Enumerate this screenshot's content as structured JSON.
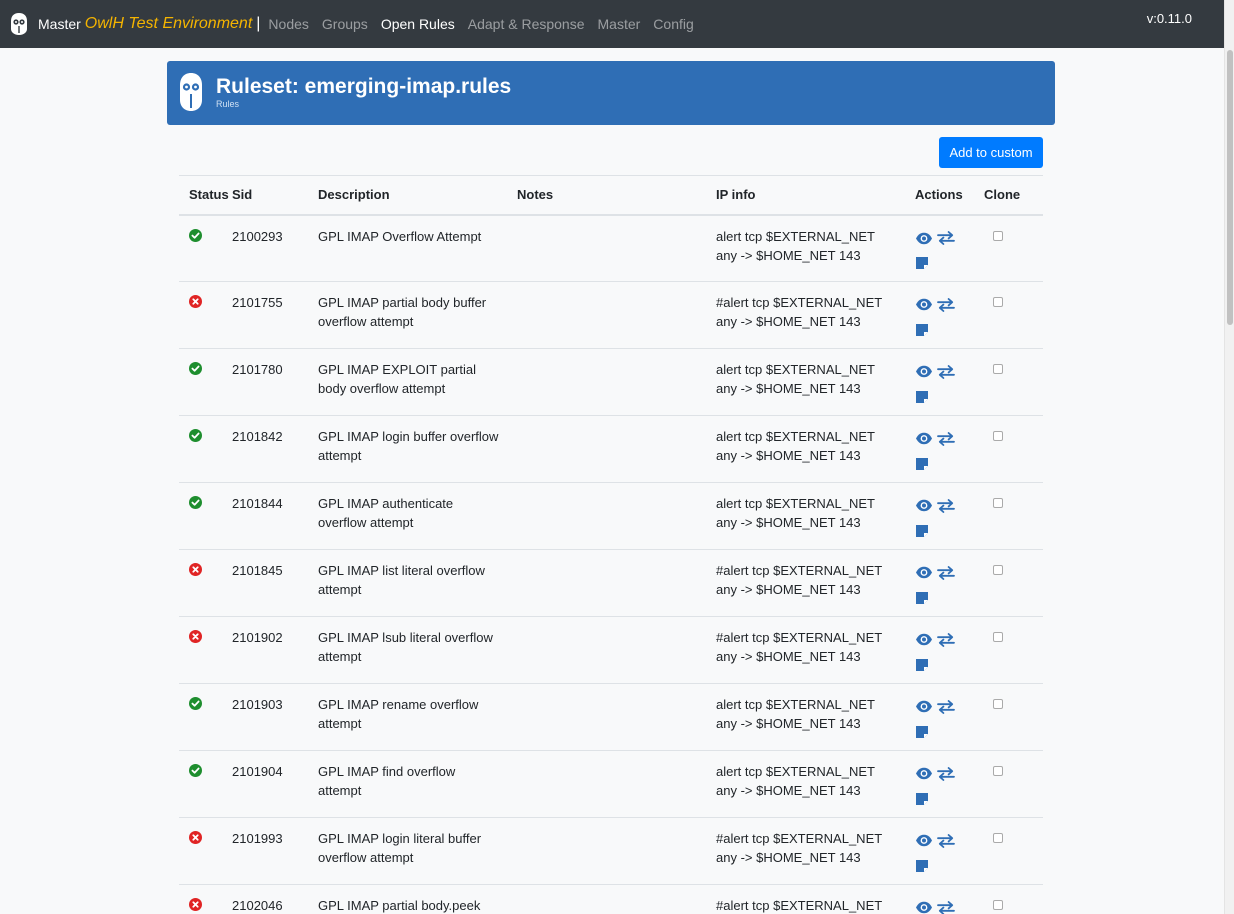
{
  "navbar": {
    "brand_master": "Master",
    "brand_env": "OwlH Test Environment",
    "separator": "|",
    "links": [
      "Nodes",
      "Groups",
      "Open Rules",
      "Adapt & Response",
      "Master",
      "Config"
    ],
    "version": "v:0.11.0"
  },
  "banner": {
    "title": "Ruleset: emerging-imap.rules",
    "subtitle": "Rules"
  },
  "add_button": "Add to custom",
  "table": {
    "headers": [
      "Status",
      "Sid",
      "Description",
      "Notes",
      "IP info",
      "Actions",
      "Clone"
    ],
    "rows": [
      {
        "status": "enabled",
        "sid": "2100293",
        "description": "GPL IMAP Overflow Attempt",
        "notes": "",
        "ip": "alert tcp $EXTERNAL_NET any -> $HOME_NET 143"
      },
      {
        "status": "disabled",
        "sid": "2101755",
        "description": "GPL IMAP partial body buffer overflow attempt",
        "notes": "",
        "ip": "#alert tcp $EXTERNAL_NET any -> $HOME_NET 143"
      },
      {
        "status": "enabled",
        "sid": "2101780",
        "description": "GPL IMAP EXPLOIT partial body overflow attempt",
        "notes": "",
        "ip": "alert tcp $EXTERNAL_NET any -> $HOME_NET 143"
      },
      {
        "status": "enabled",
        "sid": "2101842",
        "description": "GPL IMAP login buffer overflow attempt",
        "notes": "",
        "ip": "alert tcp $EXTERNAL_NET any -> $HOME_NET 143"
      },
      {
        "status": "enabled",
        "sid": "2101844",
        "description": "GPL IMAP authenticate overflow attempt",
        "notes": "",
        "ip": "alert tcp $EXTERNAL_NET any -> $HOME_NET 143"
      },
      {
        "status": "disabled",
        "sid": "2101845",
        "description": "GPL IMAP list literal overflow attempt",
        "notes": "",
        "ip": "#alert tcp $EXTERNAL_NET any -> $HOME_NET 143"
      },
      {
        "status": "disabled",
        "sid": "2101902",
        "description": "GPL IMAP lsub literal overflow attempt",
        "notes": "",
        "ip": "#alert tcp $EXTERNAL_NET any -> $HOME_NET 143"
      },
      {
        "status": "enabled",
        "sid": "2101903",
        "description": "GPL IMAP rename overflow attempt",
        "notes": "",
        "ip": "alert tcp $EXTERNAL_NET any -> $HOME_NET 143"
      },
      {
        "status": "enabled",
        "sid": "2101904",
        "description": "GPL IMAP find overflow attempt",
        "notes": "",
        "ip": "alert tcp $EXTERNAL_NET any -> $HOME_NET 143"
      },
      {
        "status": "disabled",
        "sid": "2101993",
        "description": "GPL IMAP login literal buffer overflow attempt",
        "notes": "",
        "ip": "#alert tcp $EXTERNAL_NET any -> $HOME_NET 143"
      },
      {
        "status": "disabled",
        "sid": "2102046",
        "description": "GPL IMAP partial body.peek",
        "notes": "",
        "ip": "#alert tcp $EXTERNAL_NET"
      }
    ]
  },
  "icons": {
    "view": "eye-icon",
    "change": "exchange-icon",
    "note": "note-icon",
    "enabled": "check-circle-icon",
    "disabled": "times-circle-icon"
  },
  "colors": {
    "navbar": "#343a40",
    "brand_env": "#f5b400",
    "banner": "#2f6eb5",
    "primary": "#007bff",
    "icon_blue": "#2f6eb5",
    "enabled": "#1e8e2e",
    "disabled": "#e02424"
  }
}
